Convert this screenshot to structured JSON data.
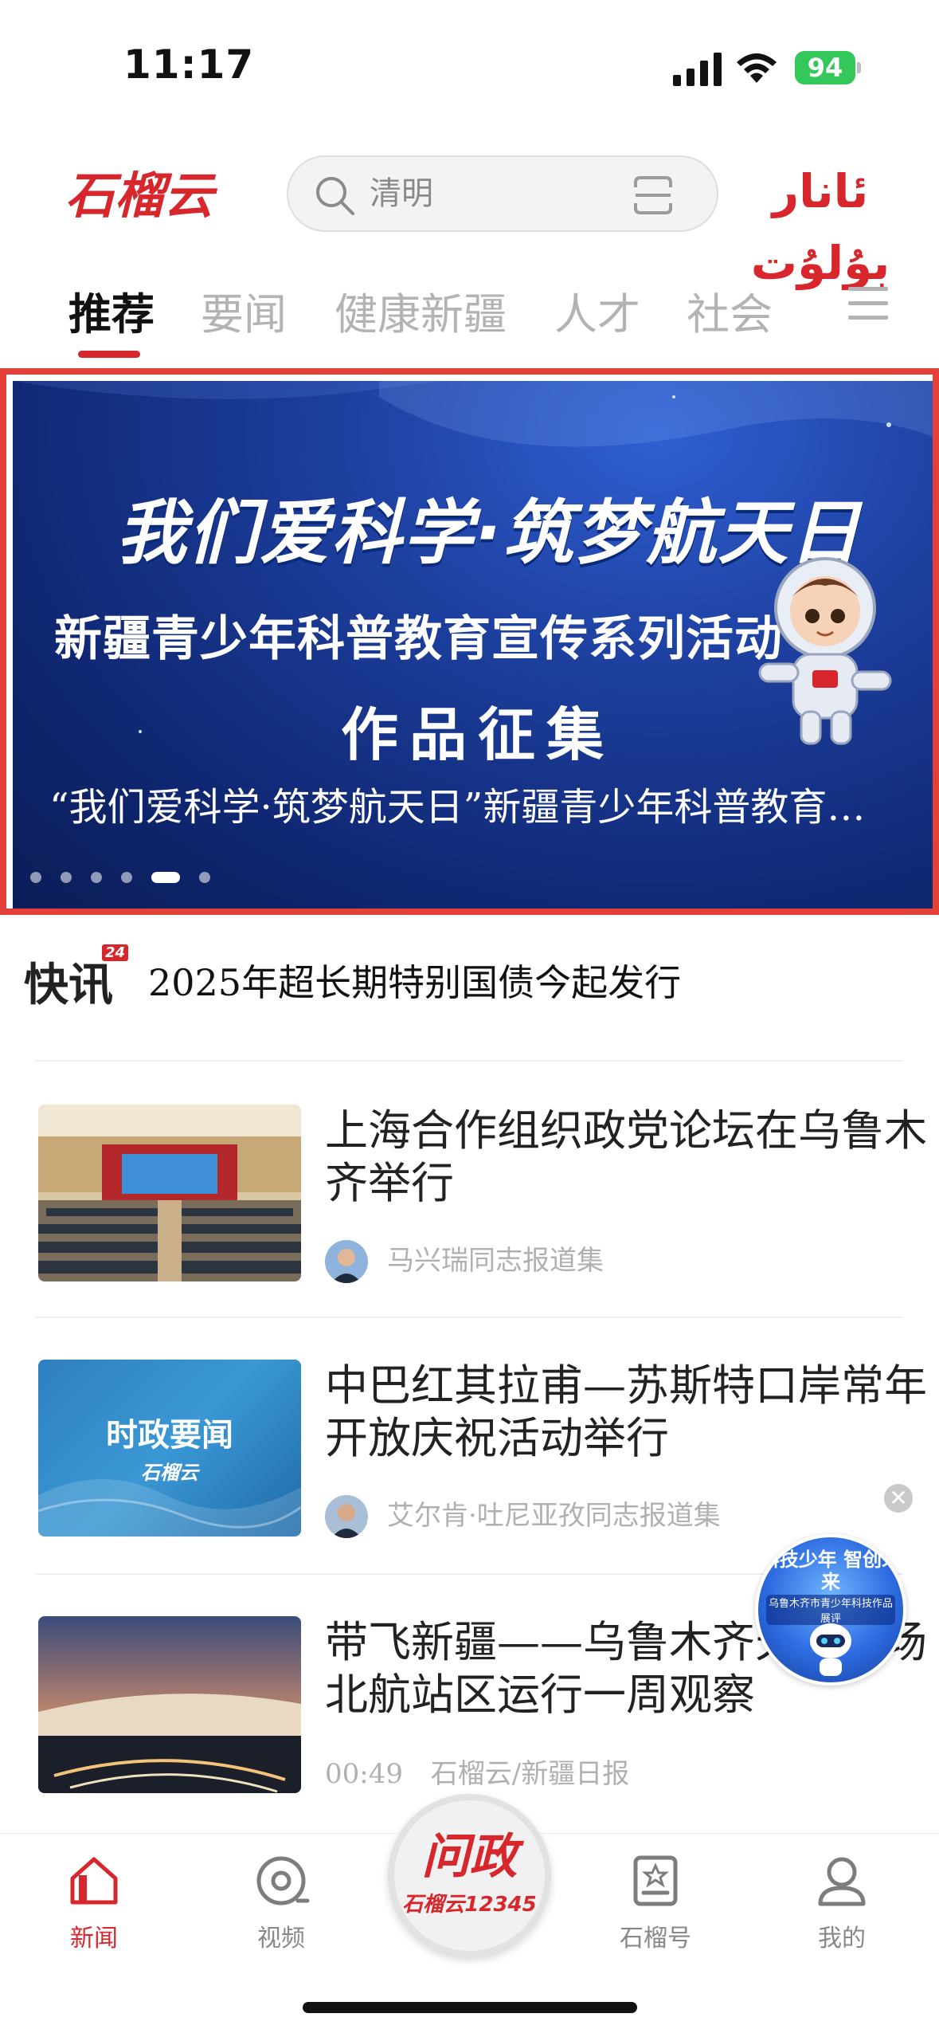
{
  "status_bar": {
    "time": "11:17",
    "battery": "94"
  },
  "header": {
    "logo_text": "石榴云",
    "search_placeholder": "清明",
    "uyghur_label": "ئانار بۇلۇت"
  },
  "tabs": [
    {
      "label": "推荐",
      "active": true
    },
    {
      "label": "要闻"
    },
    {
      "label": "健康新疆"
    },
    {
      "label": "人才"
    },
    {
      "label": "社会"
    }
  ],
  "banner": {
    "title_line1": "我们爱科学·筑梦航天日",
    "title_line2": "新疆青少年科普教育宣传系列活动",
    "title_line3": "作品征集",
    "caption": "“我们爱科学·筑梦航天日”新疆青少年科普教育…",
    "slide_count": 6,
    "active_slide": 5
  },
  "flash": {
    "badge_kuai": "快",
    "badge_xun": "讯",
    "badge_tag": "24",
    "text": "2025年超长期特别国债今起发行"
  },
  "news": [
    {
      "headline": "上海合作组织政党论坛在乌鲁木齐举行",
      "source": "马兴瑞同志报道集",
      "thumb": "conference-hall-photo"
    },
    {
      "headline": "中巴红其拉甫—苏斯特口岸常年开放庆祝活动举行",
      "source": "艾尔肯·吐尼亚孜同志报道集",
      "thumb_title": "时政要闻",
      "thumb_logo": "石榴云"
    },
    {
      "headline": "带飞新疆——乌鲁木齐天际机场北航站区运行一周观察",
      "duration": "00:49",
      "source": "石榴云/新疆日报",
      "thumb": "airport-night-photo"
    }
  ],
  "promo": {
    "title": "科技少年 智创未来",
    "subtitle": "乌鲁木齐市青少年科技作品展评",
    "close": "✕"
  },
  "bottom_nav": {
    "items": [
      {
        "label": "新闻",
        "icon": "home-icon",
        "active": true
      },
      {
        "label": "视频",
        "icon": "video-icon"
      },
      {
        "label": "石榴号",
        "icon": "badge-book-icon"
      },
      {
        "label": "我的",
        "icon": "profile-icon"
      }
    ],
    "center_top": "问政",
    "center_bottom": "石榴云12345"
  },
  "colors": {
    "accent": "#d7262c",
    "banner_border": "#e3403a",
    "banner_blue": "#1d3f9e"
  }
}
